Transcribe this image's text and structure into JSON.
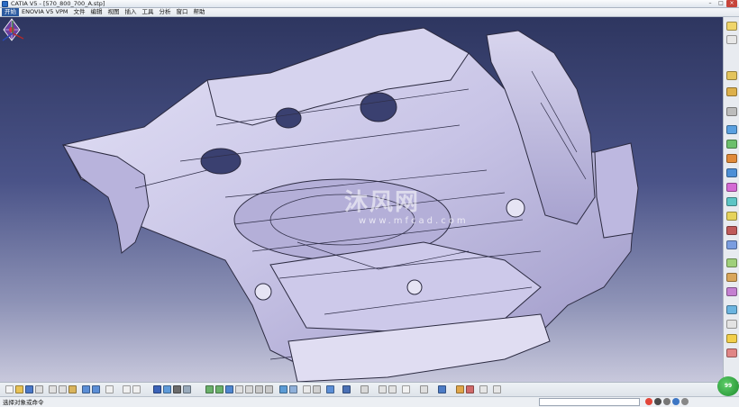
{
  "window": {
    "title": "CATIA V5 - [570_800_700_A.stp]",
    "controls": {
      "minimize": "–",
      "maximize": "□",
      "close": "×"
    }
  },
  "menu": {
    "items": [
      "开始",
      "ENOVIA V5 VPM",
      "文件",
      "编辑",
      "视图",
      "插入",
      "工具",
      "分析",
      "窗口",
      "帮助"
    ]
  },
  "viewport": {
    "model_color": "#c9c6e8",
    "background_top": "#2e3660",
    "background_bottom": "#c8c8dc"
  },
  "watermark": {
    "main": "沐风网",
    "sub": "www.mfcad.com"
  },
  "status": {
    "prompt": "选择对象或命令",
    "command_input": ""
  },
  "badge": {
    "text": "99"
  },
  "icons": {
    "compass": "compass-icon",
    "axis": "axis-triad-icon"
  },
  "colors": {
    "title_accent": "#2b5a9f",
    "toolbar_bg": "#e8ebf0"
  }
}
